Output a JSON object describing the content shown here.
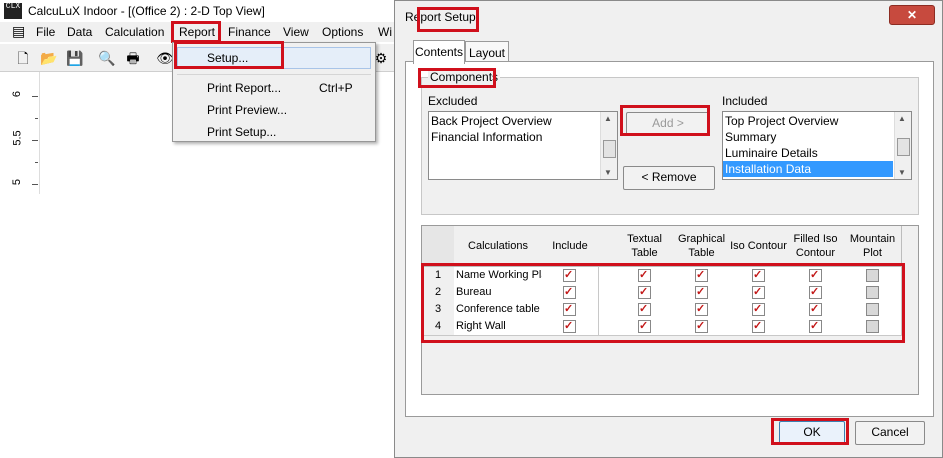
{
  "app": {
    "icon_text": "CLX",
    "title": "CalcuLuX Indoor - [(Office 2) : 2-D Top View]",
    "menu": [
      "File",
      "Data",
      "Calculation",
      "Report",
      "Finance",
      "View",
      "Options",
      "Wi"
    ],
    "ruler_labels": [
      "6",
      "5.5",
      "5"
    ]
  },
  "dropdown": {
    "items": [
      {
        "label": "Setup...",
        "shortcut": ""
      },
      {
        "label": "Print Report...",
        "shortcut": "Ctrl+P"
      },
      {
        "label": "Print Preview...",
        "shortcut": ""
      },
      {
        "label": "Print Setup...",
        "shortcut": ""
      }
    ]
  },
  "dialog": {
    "title": "Report Setup",
    "close_label": "✕",
    "tabs": [
      "Contents",
      "Layout"
    ],
    "group_label": "Components",
    "excluded_label": "Excluded",
    "included_label": "Included",
    "excluded_items": [
      "Back Project Overview",
      "Financial Information"
    ],
    "included_items": [
      "Top Project Overview",
      "Summary",
      "Luminaire Details",
      "Installation Data"
    ],
    "included_selected_index": 3,
    "add_label": "Add >",
    "remove_label": "< Remove",
    "ok_label": "OK",
    "cancel_label": "Cancel"
  },
  "grid": {
    "headers": [
      "Calculations",
      "Include",
      "",
      "Textual Table",
      "Graphical Table",
      "Iso Contour",
      "Filled Iso Contour",
      "Mountain Plot"
    ],
    "rows": [
      {
        "num": "1",
        "name": "Name Working Pla",
        "checks": [
          true,
          true,
          true,
          true,
          true,
          false
        ]
      },
      {
        "num": "2",
        "name": "Bureau",
        "checks": [
          true,
          true,
          true,
          true,
          true,
          false
        ]
      },
      {
        "num": "3",
        "name": "Conference table",
        "checks": [
          true,
          true,
          true,
          true,
          true,
          false
        ]
      },
      {
        "num": "4",
        "name": "Right Wall",
        "checks": [
          true,
          true,
          true,
          true,
          true,
          false
        ]
      }
    ]
  }
}
